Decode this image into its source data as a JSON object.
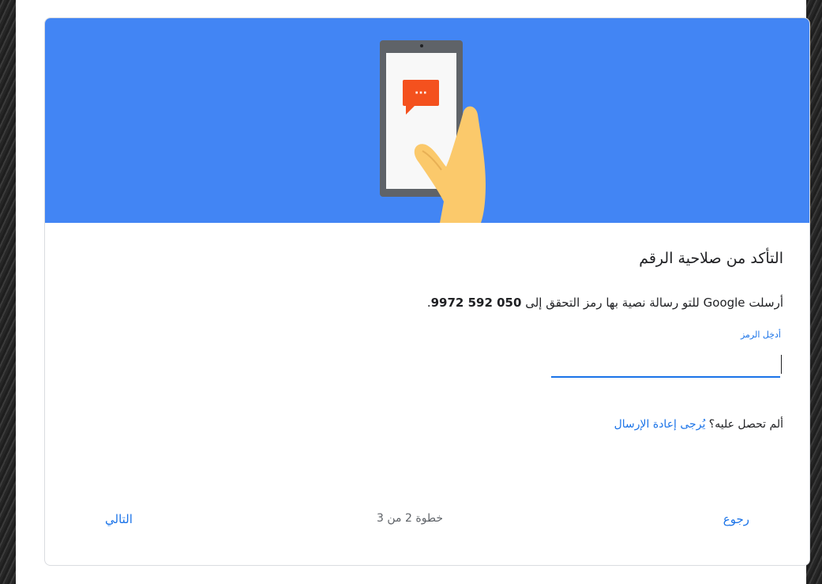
{
  "verify": {
    "title": "التأكد من صلاحية الرقم",
    "description_prefix": "أرسلت Google للتو رسالة نصية بها رمز التحقق إلى ",
    "phone_number": "050 592 9972",
    "description_suffix": ".",
    "input_label": "أدخِل الرمز",
    "input_value": "",
    "resend_question": "ألم تحصل عليه؟ ",
    "resend_link": "يُرجى إعادة الإرسال"
  },
  "footer": {
    "back_label": "رجوع",
    "step_text": "خطوة 2 من 3",
    "next_label": "التالي"
  },
  "banner": {
    "message_bubble_text": "···"
  },
  "colors": {
    "banner": "#4285f4",
    "link": "#1a73e8",
    "bubble": "#f4511e",
    "phone": "#5f6368",
    "skin": "#fbc96b"
  },
  "icons": {
    "illustration": "phone-in-hand-with-message-icon"
  }
}
